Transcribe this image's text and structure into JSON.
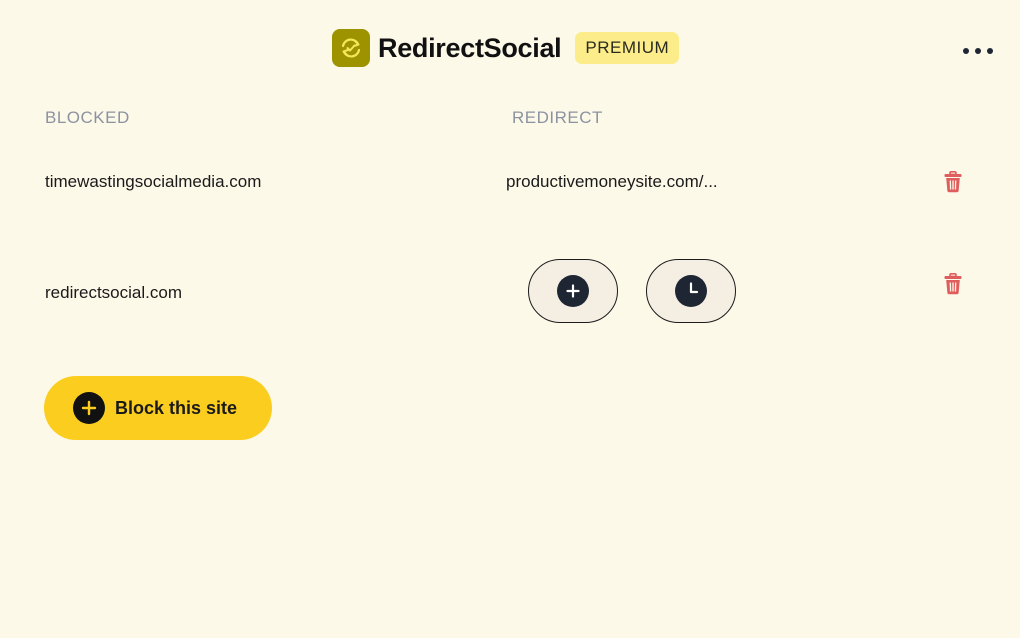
{
  "app": {
    "name": "RedirectSocial",
    "badge": "PREMIUM",
    "logo_icon": "redirect-cycle-icon",
    "menu_icon": "more-horizontal-icon"
  },
  "columns": {
    "blocked": "BLOCKED",
    "redirect": "REDIRECT"
  },
  "rules": [
    {
      "blocked": "timewastingsocialmedia.com",
      "redirect": "productivemoneysite.com/...",
      "delete_icon": "trash-icon"
    },
    {
      "blocked": "redirectsocial.com",
      "redirect": "",
      "actions": [
        "add-redirect-icon",
        "schedule-clock-icon"
      ],
      "delete_icon": "trash-icon"
    }
  ],
  "block_button": {
    "label": "Block this site",
    "icon": "plus-circle-icon"
  },
  "colors": {
    "background": "#fdf9e9",
    "accent": "#fbcd1f",
    "logo": "#9d9200",
    "badge": "#fcec8a",
    "danger": "#e05d5d",
    "header_muted": "#8c93a0",
    "dark_icon": "#1e2533"
  }
}
